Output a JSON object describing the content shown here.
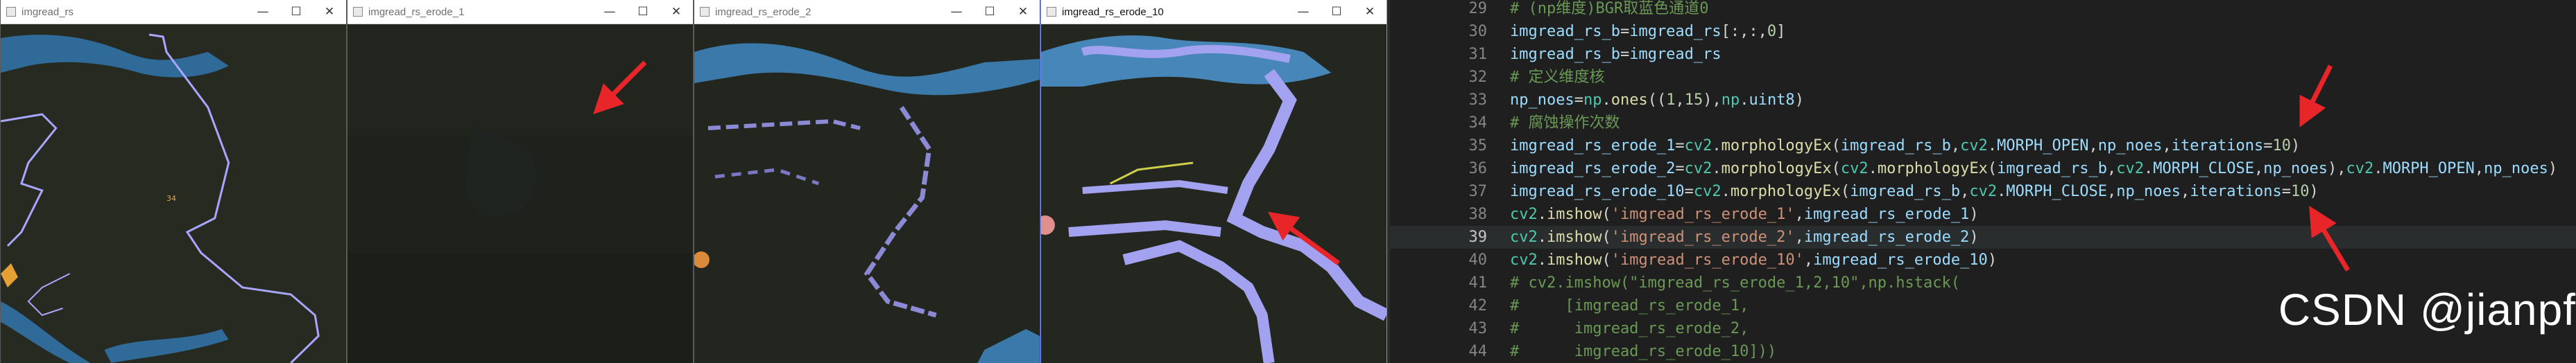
{
  "windows": [
    {
      "title": "imgread_rs",
      "minimize": "—",
      "maximize": "☐",
      "close": "✕"
    },
    {
      "title": "imgread_rs_erode_1",
      "minimize": "—",
      "maximize": "☐",
      "close": "✕"
    },
    {
      "title": "imgread_rs_erode_2",
      "minimize": "—",
      "maximize": "☐",
      "close": "✕"
    },
    {
      "title": "imgread_rs_erode_10",
      "minimize": "—",
      "maximize": "☐",
      "close": "✕"
    }
  ],
  "map_marker": "34",
  "editor": {
    "active_line": 39,
    "lines": [
      {
        "num": "29",
        "tokens": [
          {
            "c": "t-c",
            "t": "# (np维度)BGR取蓝色通道0"
          }
        ]
      },
      {
        "num": "30",
        "tokens": [
          {
            "c": "t-v",
            "t": "imgread_rs_b"
          },
          {
            "c": "t-p",
            "t": "="
          },
          {
            "c": "t-v",
            "t": "imgread_rs"
          },
          {
            "c": "t-p",
            "t": "[:,:,"
          },
          {
            "c": "t-n",
            "t": "0"
          },
          {
            "c": "t-p",
            "t": "]"
          }
        ]
      },
      {
        "num": "31",
        "tokens": [
          {
            "c": "t-v",
            "t": "imgread_rs_b"
          },
          {
            "c": "t-p",
            "t": "="
          },
          {
            "c": "t-v",
            "t": "imgread_rs"
          }
        ]
      },
      {
        "num": "32",
        "tokens": [
          {
            "c": "t-c",
            "t": "# 定义维度核"
          }
        ]
      },
      {
        "num": "33",
        "tokens": [
          {
            "c": "t-v",
            "t": "np_noes"
          },
          {
            "c": "t-p",
            "t": "="
          },
          {
            "c": "t-k",
            "t": "np"
          },
          {
            "c": "t-p",
            "t": "."
          },
          {
            "c": "t-f",
            "t": "ones"
          },
          {
            "c": "t-p",
            "t": "(("
          },
          {
            "c": "t-n",
            "t": "1"
          },
          {
            "c": "t-p",
            "t": ","
          },
          {
            "c": "t-n",
            "t": "15"
          },
          {
            "c": "t-p",
            "t": "),"
          },
          {
            "c": "t-k",
            "t": "np"
          },
          {
            "c": "t-p",
            "t": "."
          },
          {
            "c": "t-v",
            "t": "uint8"
          },
          {
            "c": "t-p",
            "t": ")"
          }
        ]
      },
      {
        "num": "34",
        "tokens": [
          {
            "c": "t-c",
            "t": "# 腐蚀操作次数"
          }
        ]
      },
      {
        "num": "35",
        "tokens": [
          {
            "c": "t-v",
            "t": "imgread_rs_erode_1"
          },
          {
            "c": "t-p",
            "t": "="
          },
          {
            "c": "t-k",
            "t": "cv2"
          },
          {
            "c": "t-p",
            "t": "."
          },
          {
            "c": "t-f",
            "t": "morphologyEx"
          },
          {
            "c": "t-p",
            "t": "("
          },
          {
            "c": "t-v",
            "t": "imgread_rs_b"
          },
          {
            "c": "t-p",
            "t": ","
          },
          {
            "c": "t-k",
            "t": "cv2"
          },
          {
            "c": "t-p",
            "t": "."
          },
          {
            "c": "t-v",
            "t": "MORPH_OPEN"
          },
          {
            "c": "t-p",
            "t": ","
          },
          {
            "c": "t-v",
            "t": "np_noes"
          },
          {
            "c": "t-p",
            "t": ","
          },
          {
            "c": "t-v",
            "t": "iterations"
          },
          {
            "c": "t-p",
            "t": "="
          },
          {
            "c": "t-n",
            "t": "10"
          },
          {
            "c": "t-p",
            "t": ")"
          }
        ]
      },
      {
        "num": "36",
        "tokens": [
          {
            "c": "t-v",
            "t": "imgread_rs_erode_2"
          },
          {
            "c": "t-p",
            "t": "="
          },
          {
            "c": "t-k",
            "t": "cv2"
          },
          {
            "c": "t-p",
            "t": "."
          },
          {
            "c": "t-f",
            "t": "morphologyEx"
          },
          {
            "c": "t-p",
            "t": "("
          },
          {
            "c": "t-k",
            "t": "cv2"
          },
          {
            "c": "t-p",
            "t": "."
          },
          {
            "c": "t-f",
            "t": "morphologyEx"
          },
          {
            "c": "t-p",
            "t": "("
          },
          {
            "c": "t-v",
            "t": "imgread_rs_b"
          },
          {
            "c": "t-p",
            "t": ","
          },
          {
            "c": "t-k",
            "t": "cv2"
          },
          {
            "c": "t-p",
            "t": "."
          },
          {
            "c": "t-v",
            "t": "MORPH_CLOSE"
          },
          {
            "c": "t-p",
            "t": ","
          },
          {
            "c": "t-v",
            "t": "np_noes"
          },
          {
            "c": "t-p",
            "t": "),"
          },
          {
            "c": "t-k",
            "t": "cv2"
          },
          {
            "c": "t-p",
            "t": "."
          },
          {
            "c": "t-v",
            "t": "MORPH_OPEN"
          },
          {
            "c": "t-p",
            "t": ","
          },
          {
            "c": "t-v",
            "t": "np_noes"
          },
          {
            "c": "t-p",
            "t": ")"
          }
        ]
      },
      {
        "num": "37",
        "tokens": [
          {
            "c": "t-v",
            "t": "imgread_rs_erode_10"
          },
          {
            "c": "t-p",
            "t": "="
          },
          {
            "c": "t-k",
            "t": "cv2"
          },
          {
            "c": "t-p",
            "t": "."
          },
          {
            "c": "t-f",
            "t": "morphologyEx"
          },
          {
            "c": "t-p",
            "t": "("
          },
          {
            "c": "t-v",
            "t": "imgread_rs_b"
          },
          {
            "c": "t-p",
            "t": ","
          },
          {
            "c": "t-k",
            "t": "cv2"
          },
          {
            "c": "t-p",
            "t": "."
          },
          {
            "c": "t-v",
            "t": "MORPH_CLOSE"
          },
          {
            "c": "t-p",
            "t": ","
          },
          {
            "c": "t-v",
            "t": "np_noes"
          },
          {
            "c": "t-p",
            "t": ","
          },
          {
            "c": "t-v",
            "t": "iterations"
          },
          {
            "c": "t-p",
            "t": "="
          },
          {
            "c": "t-n",
            "t": "10"
          },
          {
            "c": "t-p",
            "t": ")"
          }
        ]
      },
      {
        "num": "38",
        "tokens": [
          {
            "c": "t-k",
            "t": "cv2"
          },
          {
            "c": "t-p",
            "t": "."
          },
          {
            "c": "t-f",
            "t": "imshow"
          },
          {
            "c": "t-p",
            "t": "("
          },
          {
            "c": "t-s",
            "t": "'imgread_rs_erode_1'"
          },
          {
            "c": "t-p",
            "t": ","
          },
          {
            "c": "t-v",
            "t": "imgread_rs_erode_1"
          },
          {
            "c": "t-p",
            "t": ")"
          }
        ]
      },
      {
        "num": "39",
        "tokens": [
          {
            "c": "t-k",
            "t": "cv2"
          },
          {
            "c": "t-p",
            "t": "."
          },
          {
            "c": "t-f",
            "t": "imshow"
          },
          {
            "c": "t-p",
            "t": "("
          },
          {
            "c": "t-s",
            "t": "'imgread_rs_erode_2'"
          },
          {
            "c": "t-p",
            "t": ","
          },
          {
            "c": "t-v",
            "t": "imgread_rs_erode_2"
          },
          {
            "c": "t-p",
            "t": ")"
          }
        ]
      },
      {
        "num": "40",
        "tokens": [
          {
            "c": "t-k",
            "t": "cv2"
          },
          {
            "c": "t-p",
            "t": "."
          },
          {
            "c": "t-f",
            "t": "imshow"
          },
          {
            "c": "t-p",
            "t": "("
          },
          {
            "c": "t-s",
            "t": "'imgread_rs_erode_10'"
          },
          {
            "c": "t-p",
            "t": ","
          },
          {
            "c": "t-v",
            "t": "imgread_rs_erode_10"
          },
          {
            "c": "t-p",
            "t": ")"
          }
        ]
      },
      {
        "num": "41",
        "tokens": [
          {
            "c": "t-c",
            "t": "# cv2.imshow(\"imgread_rs_erode_1,2,10\",np.hstack("
          }
        ]
      },
      {
        "num": "42",
        "tokens": [
          {
            "c": "t-c",
            "t": "#     [imgread_rs_erode_1,"
          }
        ]
      },
      {
        "num": "43",
        "tokens": [
          {
            "c": "t-c",
            "t": "#      imgread_rs_erode_2,"
          }
        ]
      },
      {
        "num": "44",
        "tokens": [
          {
            "c": "t-c",
            "t": "#      imgread_rs_erode_10]))"
          }
        ]
      }
    ]
  },
  "watermark": "CSDN @jianpf",
  "colors": {
    "arrow": "#e8262a",
    "outline": "#a9a6ff",
    "river": "#4a86b8"
  }
}
